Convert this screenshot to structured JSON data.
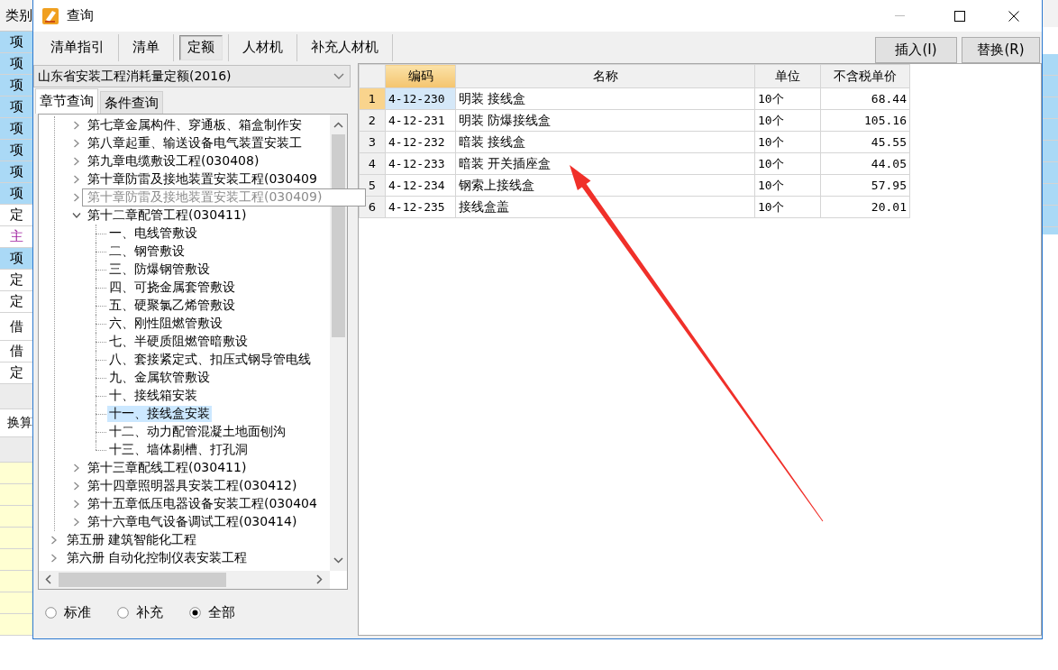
{
  "background_table": {
    "header": "类别",
    "cells": [
      {
        "text": "项",
        "kind": "item"
      },
      {
        "text": "项",
        "kind": "item"
      },
      {
        "text": "项",
        "kind": "item"
      },
      {
        "text": "项",
        "kind": "item"
      },
      {
        "text": "项",
        "kind": "item"
      },
      {
        "text": "项",
        "kind": "item"
      },
      {
        "text": "项",
        "kind": "item"
      },
      {
        "text": "项",
        "kind": "item"
      },
      {
        "text": "定",
        "kind": "plain"
      },
      {
        "text": "主",
        "kind": "main"
      },
      {
        "text": "项",
        "kind": "item"
      },
      {
        "text": "定",
        "kind": "plain"
      },
      {
        "text": "定",
        "kind": "plain"
      },
      {
        "text": "借",
        "kind": "tall"
      },
      {
        "text": "借",
        "kind": "plain"
      },
      {
        "text": "定",
        "kind": "plain"
      },
      {
        "kind": "blank"
      },
      {
        "text": "换算",
        "kind": "label"
      },
      {
        "kind": "blank"
      },
      {
        "kind": "input"
      },
      {
        "kind": "input"
      },
      {
        "kind": "input"
      },
      {
        "kind": "input"
      },
      {
        "kind": "input"
      },
      {
        "kind": "input"
      },
      {
        "kind": "input"
      },
      {
        "kind": "input"
      }
    ]
  },
  "window": {
    "title": "查询"
  },
  "toolbar": {
    "tabs": [
      {
        "label": "清单指引",
        "selected": false
      },
      {
        "label": "清单",
        "selected": false
      },
      {
        "label": "定额",
        "selected": true
      },
      {
        "label": "人材机",
        "selected": false
      },
      {
        "label": "补充人材机",
        "selected": false
      }
    ],
    "buttons": [
      "插入(I)",
      "替换(R)"
    ]
  },
  "library_dropdown": {
    "value": "山东省安装工程消耗量定额(2016)"
  },
  "search_tabs": [
    {
      "label": "章节查询",
      "selected": true
    },
    {
      "label": "条件查询",
      "selected": false
    }
  ],
  "tree": {
    "items": [
      {
        "expanded": true,
        "children": [
          {
            "label": "第七章金属构件、穿通板、箱盒制作安",
            "expanded": false,
            "selected": false
          },
          {
            "label": "第八章起重、输送设备电气装置安装工",
            "expanded": false,
            "selected": false
          },
          {
            "label": "第九章电缆敷设工程(030408)",
            "expanded": false,
            "selected": false
          },
          {
            "label": "第十章防雷及接地装置安装工程(030409",
            "expanded": false,
            "selected": false
          },
          {
            "kind": "tooltip",
            "label": "第十章防雷及接地装置安装工程(030409)",
            "expanded": false
          },
          {
            "label": "第十二章配管工程(030411)",
            "expanded": true,
            "selected": false,
            "children": [
              {
                "label": "一、电线管敷设",
                "selected": false
              },
              {
                "label": "二、钢管敷设",
                "selected": false
              },
              {
                "label": "三、防爆钢管敷设",
                "selected": false
              },
              {
                "label": "四、可挠金属套管敷设",
                "selected": false
              },
              {
                "label": "五、硬聚氯乙烯管敷设",
                "selected": false
              },
              {
                "label": "六、刚性阻燃管敷设",
                "selected": false
              },
              {
                "label": "七、半硬质阻燃管暗敷设",
                "selected": false
              },
              {
                "label": "八、套接紧定式、扣压式钢导管电线",
                "selected": false
              },
              {
                "label": "九、金属软管敷设",
                "selected": false
              },
              {
                "label": "十、接线箱安装",
                "selected": false
              },
              {
                "label": "十一、接线盒安装",
                "selected": true
              },
              {
                "label": "十二、动力配管混凝土地面刨沟",
                "selected": false
              },
              {
                "label": "十三、墙体剔槽、打孔洞",
                "selected": false
              }
            ]
          },
          {
            "label": "第十三章配线工程(030411)",
            "expanded": false,
            "selected": false
          },
          {
            "label": "第十四章照明器具安装工程(030412)",
            "expanded": false,
            "selected": false
          },
          {
            "label": "第十五章低压电器设备安装工程(030404",
            "expanded": false,
            "selected": false
          },
          {
            "label": "第十六章电气设备调试工程(030414)",
            "expanded": false,
            "selected": false
          }
        ]
      },
      {
        "label": "第五册 建筑智能化工程",
        "expanded": false,
        "selected": false
      },
      {
        "label": "第六册 自动化控制仪表安装工程",
        "expanded": false,
        "selected": false
      }
    ]
  },
  "filter": [
    {
      "label": "标准",
      "selected": false
    },
    {
      "label": "补充",
      "selected": false
    },
    {
      "label": "全部",
      "selected": true
    }
  ],
  "table": {
    "columns": [
      {
        "label": "编码",
        "selected": true
      },
      {
        "label": "名称",
        "selected": false
      },
      {
        "label": "单位",
        "selected": false
      },
      {
        "label": "不含税单价",
        "selected": false
      }
    ],
    "rows": [
      {
        "number": "1",
        "code": "4-12-230",
        "name": "明装 接线盒",
        "unit": "10个",
        "price": "68.44",
        "selected": true
      },
      {
        "number": "2",
        "code": "4-12-231",
        "name": "明装 防爆接线盒",
        "unit": "10个",
        "price": "105.16",
        "selected": false
      },
      {
        "number": "3",
        "code": "4-12-232",
        "name": "暗装 接线盒",
        "unit": "10个",
        "price": "45.55",
        "selected": false
      },
      {
        "number": "4",
        "code": "4-12-233",
        "name": "暗装 开关插座盒",
        "unit": "10个",
        "price": "44.05",
        "selected": false
      },
      {
        "number": "5",
        "code": "4-12-234",
        "name": "钢索上接线盒",
        "unit": "10个",
        "price": "57.95",
        "selected": false
      },
      {
        "number": "6",
        "code": "4-12-235",
        "name": "接线盒盖",
        "unit": "10个",
        "price": "20.01",
        "selected": false
      }
    ]
  },
  "annotations": [
    {
      "kind": "arrow",
      "color": "#f0302a"
    }
  ]
}
